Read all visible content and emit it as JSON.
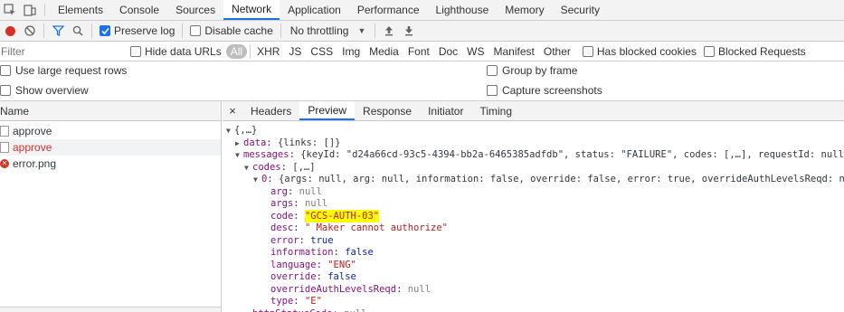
{
  "devtools_tabs": [
    "Elements",
    "Console",
    "Sources",
    "Network",
    "Application",
    "Performance",
    "Lighthouse",
    "Memory",
    "Security"
  ],
  "active_tab": "Network",
  "toolbar": {
    "preserve_log": "Preserve log",
    "disable_cache": "Disable cache",
    "throttling": "No throttling"
  },
  "filter": {
    "placeholder": "Filter",
    "hide_data_urls": "Hide data URLs",
    "types": [
      "All",
      "XHR",
      "JS",
      "CSS",
      "Img",
      "Media",
      "Font",
      "Doc",
      "WS",
      "Manifest",
      "Other"
    ],
    "has_blocked_cookies": "Has blocked cookies",
    "blocked_requests": "Blocked Requests"
  },
  "settings": {
    "large_rows": "Use large request rows",
    "group_by_frame": "Group by frame",
    "show_overview": "Show overview",
    "capture_screenshots": "Capture screenshots"
  },
  "list": {
    "header": "Name",
    "requests": [
      {
        "name": "approve",
        "state": "normal"
      },
      {
        "name": "approve",
        "state": "error"
      },
      {
        "name": "error.png",
        "state": "error-icon"
      }
    ]
  },
  "detail": {
    "tabs": [
      "Headers",
      "Preview",
      "Response",
      "Initiator",
      "Timing"
    ],
    "active": "Preview",
    "close": "×",
    "tree": {
      "root": "{,…}",
      "data_key": "data",
      "data_val": "{links: []}",
      "messages_key": "messages",
      "messages_val": "{keyId: \"d24a66cd-93c5-4394-bb2a-6465385adfdb\", status: \"FAILURE\", codes: [,…], requestId: null,…}",
      "codes_key": "codes",
      "codes_val": "[,…]",
      "item_key": "0",
      "item_val": "{args: null, arg: null, information: false, override: false, error: true, overrideAuthLevelsReqd: null,…}",
      "fields": [
        {
          "k": "arg",
          "v": "null",
          "t": "nul"
        },
        {
          "k": "args",
          "v": "null",
          "t": "nul"
        },
        {
          "k": "code",
          "v": "\"GCS-AUTH-03\"",
          "t": "s",
          "hl": true
        },
        {
          "k": "desc",
          "v": "\" Maker cannot authorize\"",
          "t": "s"
        },
        {
          "k": "error",
          "v": "true",
          "t": "bool"
        },
        {
          "k": "information",
          "v": "false",
          "t": "bool"
        },
        {
          "k": "language",
          "v": "\"ENG\"",
          "t": "s"
        },
        {
          "k": "override",
          "v": "false",
          "t": "bool"
        },
        {
          "k": "overrideAuthLevelsReqd",
          "v": "null",
          "t": "nul"
        },
        {
          "k": "type",
          "v": "\"E\"",
          "t": "s"
        }
      ],
      "trailing_key": "httpStatusCode",
      "trailing_val": "null"
    }
  },
  "colors": {
    "accent": "#1a73e8",
    "record": "#d93025",
    "highlight": "#ffff00"
  }
}
